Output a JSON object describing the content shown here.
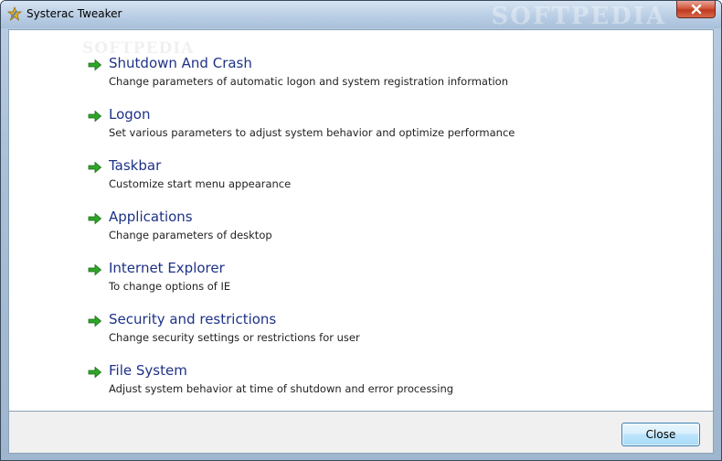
{
  "window": {
    "title": "Systerac Tweaker",
    "titlebar_watermark": "SOFTPEDIA",
    "client_watermark": "SOFTPEDIA"
  },
  "icons": {
    "app": "wrench-star-icon",
    "close": "close-icon",
    "item": "green-arrow-icon"
  },
  "colors": {
    "link": "#1e3287",
    "arrow": "#2fa52a",
    "close_button_border": "#3c7fb1"
  },
  "items": [
    {
      "label": "Shutdown And Crash",
      "description": "Change parameters of automatic logon and system registration information"
    },
    {
      "label": "Logon",
      "description": "Set various parameters to adjust system behavior and optimize performance"
    },
    {
      "label": "Taskbar",
      "description": "Customize start menu appearance"
    },
    {
      "label": "Applications",
      "description": "Change parameters of desktop"
    },
    {
      "label": "Internet Explorer",
      "description": "To change options of IE"
    },
    {
      "label": "Security and restrictions",
      "description": "Change security settings or restrictions for user"
    },
    {
      "label": "File System",
      "description": "Adjust system behavior at time of shutdown and error processing"
    }
  ],
  "footer": {
    "close_label": "Close"
  }
}
